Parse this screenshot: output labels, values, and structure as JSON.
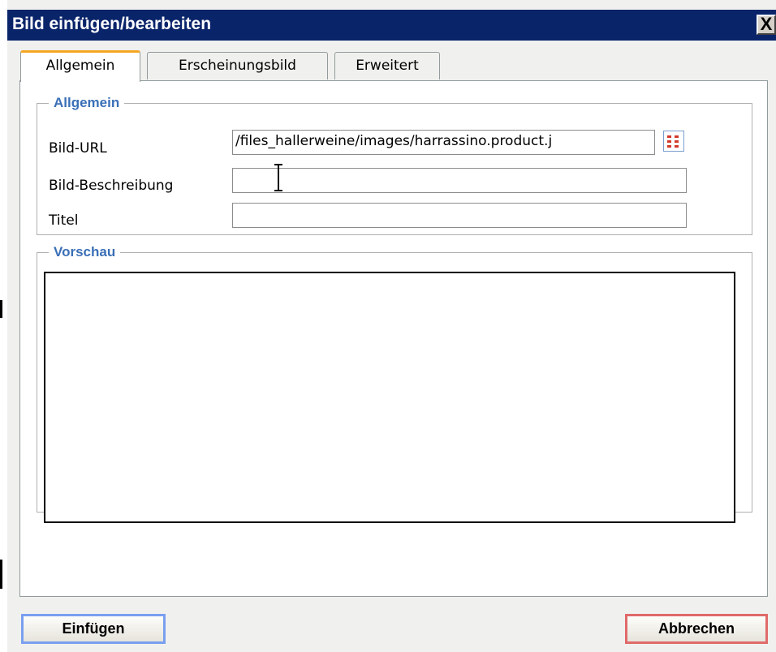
{
  "dialog": {
    "title": "Bild einfügen/bearbeiten",
    "close_label": "X"
  },
  "tabs": [
    {
      "label": "Allgemein",
      "active": true
    },
    {
      "label": "Erscheinungsbild",
      "active": false
    },
    {
      "label": "Erweitert",
      "active": false
    }
  ],
  "general": {
    "legend": "Allgemein",
    "fields": {
      "url": {
        "label": "Bild-URL",
        "value": "/files_hallerweine/images/harrassino.product.j"
      },
      "description": {
        "label": "Bild-Beschreibung",
        "value": ""
      },
      "title": {
        "label": "Titel",
        "value": ""
      }
    }
  },
  "preview": {
    "legend": "Vorschau"
  },
  "buttons": {
    "insert": "Einfügen",
    "cancel": "Abbrechen"
  },
  "colors": {
    "titlebar": "#0a246a",
    "legend": "#3a6fb7",
    "active_tab_accent": "#f5a623"
  }
}
